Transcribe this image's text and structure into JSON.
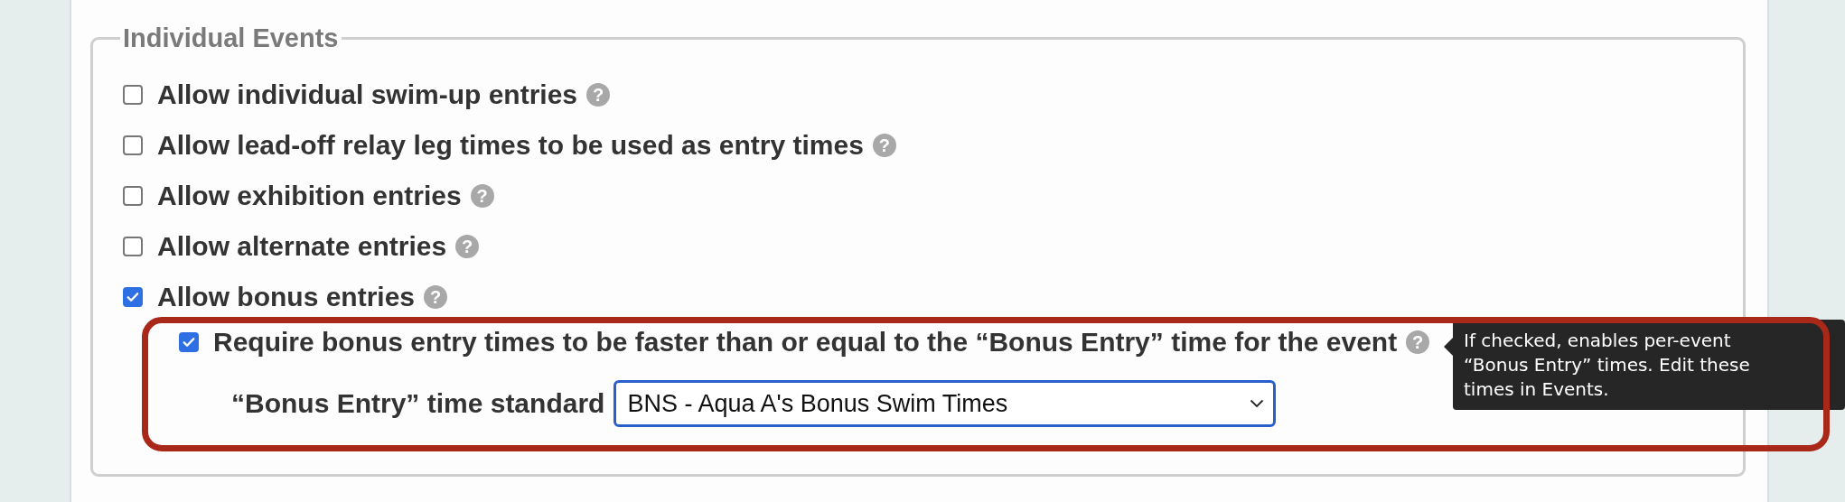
{
  "section": {
    "legend": "Individual Events",
    "options": [
      {
        "label": "Allow individual swim-up entries",
        "checked": false,
        "help": "?"
      },
      {
        "label": "Allow lead-off relay leg times to be used as entry times",
        "checked": false,
        "help": "?"
      },
      {
        "label": "Allow exhibition entries",
        "checked": false,
        "help": "?"
      },
      {
        "label": "Allow alternate entries",
        "checked": false,
        "help": "?"
      },
      {
        "label": "Allow bonus entries",
        "checked": true,
        "help": "?"
      }
    ],
    "sub_options": [
      {
        "kind": "checkbox",
        "label": "Require bonus entry times to be faster than or equal to the “Bonus Entry” time for the event",
        "checked": true,
        "help": "?"
      },
      {
        "kind": "select",
        "label": "“Bonus Entry” time standard",
        "value": "BNS - Aqua A's Bonus Swim Times"
      }
    ]
  },
  "tooltip": {
    "text": "If checked, enables per-event “Bonus Entry” times. Edit these times in Events."
  }
}
